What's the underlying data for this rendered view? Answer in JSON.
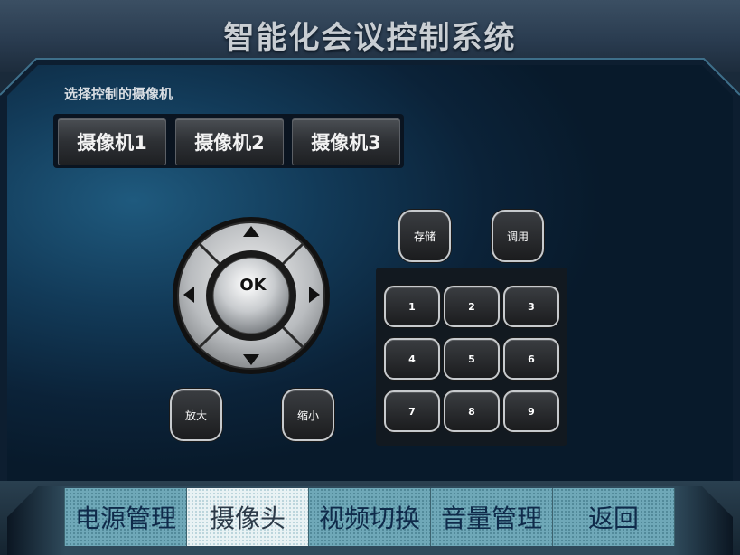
{
  "header": {
    "title": "智能化会议控制系统"
  },
  "camera_select": {
    "label": "选择控制的摄像机",
    "buttons": [
      "摄像机1",
      "摄像机2",
      "摄像机3"
    ]
  },
  "dpad": {
    "center_label": "OK"
  },
  "zoom": {
    "in_label": "放大",
    "out_label": "缩小"
  },
  "presets": {
    "store_label": "存储",
    "recall_label": "调用"
  },
  "keypad": {
    "keys": [
      "1",
      "2",
      "3",
      "4",
      "5",
      "6",
      "7",
      "8",
      "9"
    ]
  },
  "nav": {
    "items": [
      "电源管理",
      "摄像头",
      "视频切换",
      "音量管理",
      "返回"
    ],
    "active_index": 1
  },
  "colors": {
    "nav_tile": "#6fa8b8",
    "nav_active": "#e9f2f4",
    "nav_text": "#0f2a4a",
    "button_border": "#c7cacd"
  }
}
